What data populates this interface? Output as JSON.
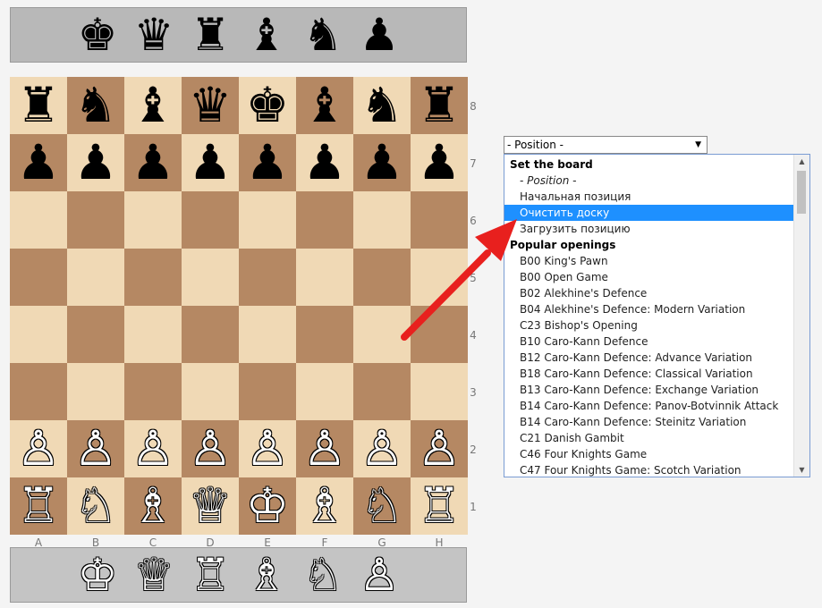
{
  "spare_top": {
    "pieces": [
      {
        "name": "black-king-icon",
        "glyph": "♚"
      },
      {
        "name": "black-queen-icon",
        "glyph": "♛"
      },
      {
        "name": "black-rook-icon",
        "glyph": "♜"
      },
      {
        "name": "black-bishop-icon",
        "glyph": "♝"
      },
      {
        "name": "black-knight-icon",
        "glyph": "♞"
      },
      {
        "name": "black-pawn-icon",
        "glyph": "♟"
      }
    ]
  },
  "spare_bottom": {
    "pieces": [
      {
        "name": "white-king-icon",
        "glyph": "♔"
      },
      {
        "name": "white-queen-icon",
        "glyph": "♕"
      },
      {
        "name": "white-rook-icon",
        "glyph": "♖"
      },
      {
        "name": "white-bishop-icon",
        "glyph": "♗"
      },
      {
        "name": "white-knight-icon",
        "glyph": "♘"
      },
      {
        "name": "white-pawn-icon",
        "glyph": "♙"
      }
    ]
  },
  "board": {
    "ranks": [
      "8",
      "7",
      "6",
      "5",
      "4",
      "3",
      "2",
      "1"
    ],
    "files": [
      "A",
      "B",
      "C",
      "D",
      "E",
      "F",
      "G",
      "H"
    ],
    "position": [
      [
        "r",
        "n",
        "b",
        "q",
        "k",
        "b",
        "n",
        "r"
      ],
      [
        "p",
        "p",
        "p",
        "p",
        "p",
        "p",
        "p",
        "p"
      ],
      [
        "",
        "",
        "",
        "",
        "",
        "",
        "",
        ""
      ],
      [
        "",
        "",
        "",
        "",
        "",
        "",
        "",
        ""
      ],
      [
        "",
        "",
        "",
        "",
        "",
        "",
        "",
        ""
      ],
      [
        "",
        "",
        "",
        "",
        "",
        "",
        "",
        ""
      ],
      [
        "P",
        "P",
        "P",
        "P",
        "P",
        "P",
        "P",
        "P"
      ],
      [
        "R",
        "N",
        "B",
        "Q",
        "K",
        "B",
        "N",
        "R"
      ]
    ],
    "colors": {
      "light": "#f0d9b5",
      "dark": "#b58863"
    }
  },
  "position_select": {
    "value": "- Position -",
    "options": [
      {
        "label": "Set the board",
        "type": "group"
      },
      {
        "label": "- Position -",
        "type": "italic"
      },
      {
        "label": "Начальная позиция",
        "type": "option"
      },
      {
        "label": "Очистить доску",
        "type": "option",
        "selected": true
      },
      {
        "label": "Загрузить позицию",
        "type": "option"
      },
      {
        "label": "Popular openings",
        "type": "group"
      },
      {
        "label": "B00 King's Pawn",
        "type": "option"
      },
      {
        "label": "B00 Open Game",
        "type": "option"
      },
      {
        "label": "B02 Alekhine's Defence",
        "type": "option"
      },
      {
        "label": "B04 Alekhine's Defence: Modern Variation",
        "type": "option"
      },
      {
        "label": "C23 Bishop's Opening",
        "type": "option"
      },
      {
        "label": "B10 Caro-Kann Defence",
        "type": "option"
      },
      {
        "label": "B12 Caro-Kann Defence: Advance Variation",
        "type": "option"
      },
      {
        "label": "B18 Caro-Kann Defence: Classical Variation",
        "type": "option"
      },
      {
        "label": "B13 Caro-Kann Defence: Exchange Variation",
        "type": "option"
      },
      {
        "label": "B14 Caro-Kann Defence: Panov-Botvinnik Attack",
        "type": "option"
      },
      {
        "label": "B14 Caro-Kann Defence: Steinitz Variation",
        "type": "option"
      },
      {
        "label": "C21 Danish Gambit",
        "type": "option"
      },
      {
        "label": "C46 Four Knights Game",
        "type": "option"
      },
      {
        "label": "C47 Four Knights Game: Scotch Variation",
        "type": "option"
      }
    ],
    "highlight_color": "#1e90ff"
  },
  "annotation": {
    "color": "#e8201e"
  }
}
